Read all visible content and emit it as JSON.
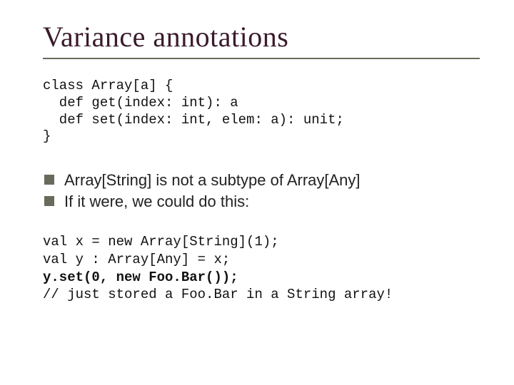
{
  "title": "Variance annotations",
  "code_block_1": {
    "l1": "class Array[a] {",
    "l2": "  def get(index: int): a",
    "l3": "  def set(index: int, elem: a): unit;",
    "l4": "}"
  },
  "bullets": [
    "Array[String] is not a subtype of Array[Any]",
    "If it were, we could do this:"
  ],
  "code_block_2": {
    "l1": "val x = new Array[String](1);",
    "l2": "val y : Array[Any] = x;",
    "l3": "y.set(0, new Foo.Bar());",
    "l4": "// just stored a Foo.Bar in a String array!"
  }
}
